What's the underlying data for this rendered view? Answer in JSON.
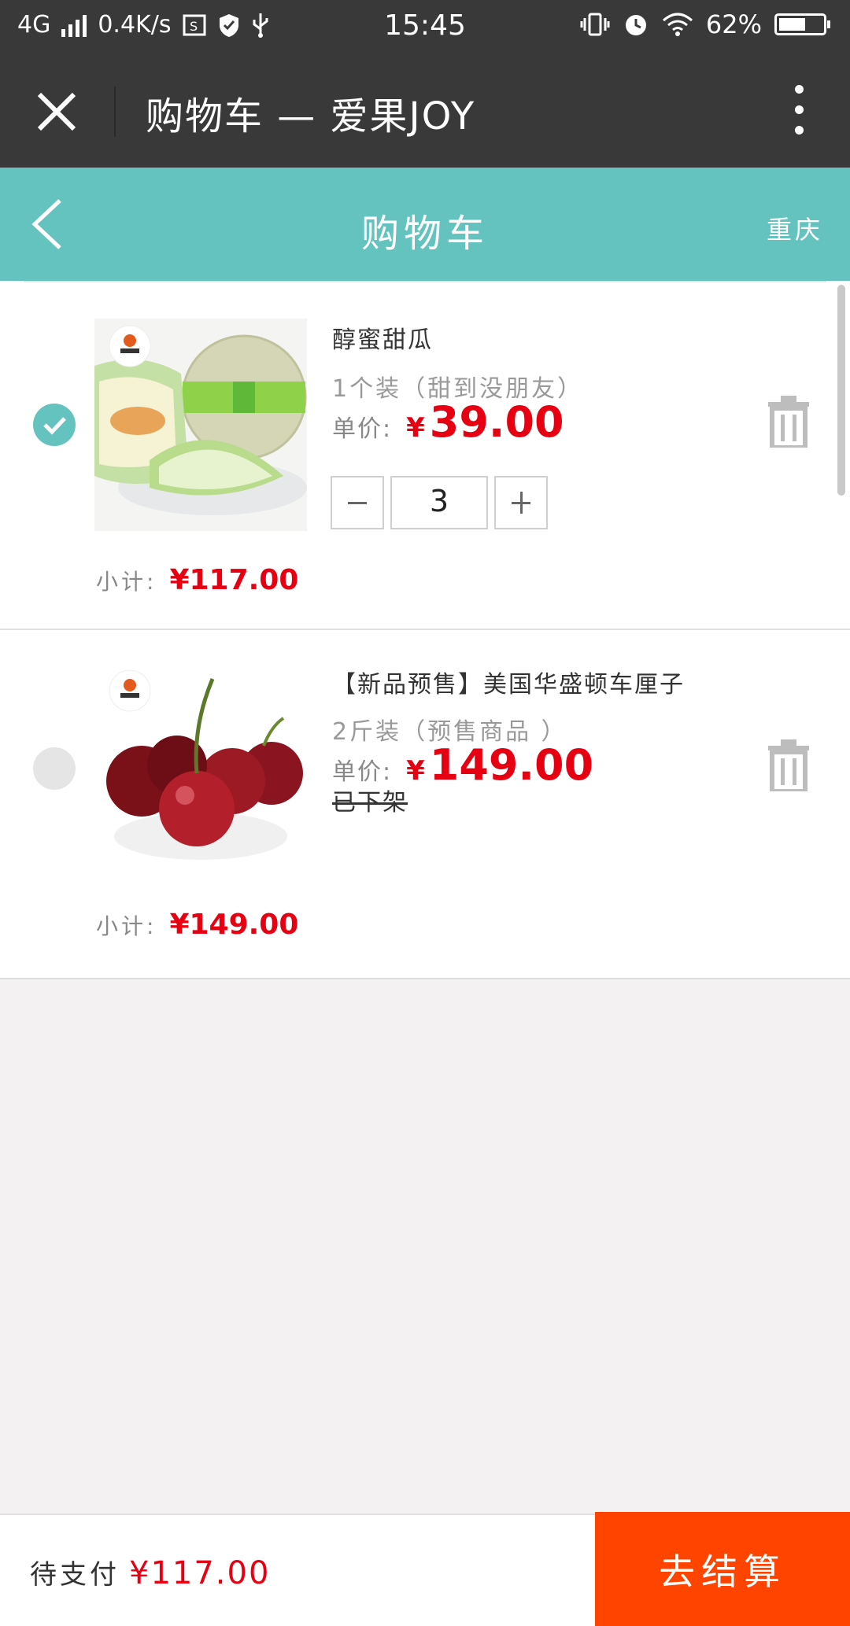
{
  "status_bar": {
    "network": "4G",
    "speed": "0.4K/s",
    "time": "15:45",
    "battery_percent": "62%",
    "battery_level": 0.62
  },
  "webview": {
    "title": "购物车 — 爱果JOY"
  },
  "header": {
    "title": "购物车",
    "city": "重庆"
  },
  "cart": {
    "items": [
      {
        "name": "醇蜜甜瓜",
        "spec": "1个装（甜到没朋友）",
        "price_label": "单价:",
        "currency": "¥",
        "price": "39.00",
        "quantity": "3",
        "subtotal_label": "小计:",
        "subtotal": "¥117.00",
        "selected": true,
        "image": "melon-image"
      },
      {
        "name": "【新品预售】美国华盛顿车厘子",
        "spec": "2斤装（预售商品 ）",
        "price_label": "单价:",
        "currency": "¥",
        "price": "149.00",
        "status": "已下架",
        "subtotal_label": "小计:",
        "subtotal": "¥149.00",
        "selected": false,
        "image": "cherry-image"
      }
    ]
  },
  "footer": {
    "pending_label": "待支付",
    "pending_amount": "¥117.00",
    "checkout_label": "去结算"
  },
  "colors": {
    "accent": "#64c3bf",
    "price_red": "#e60012",
    "checkout_orange": "#ff4400",
    "bar_dark": "#393939"
  }
}
